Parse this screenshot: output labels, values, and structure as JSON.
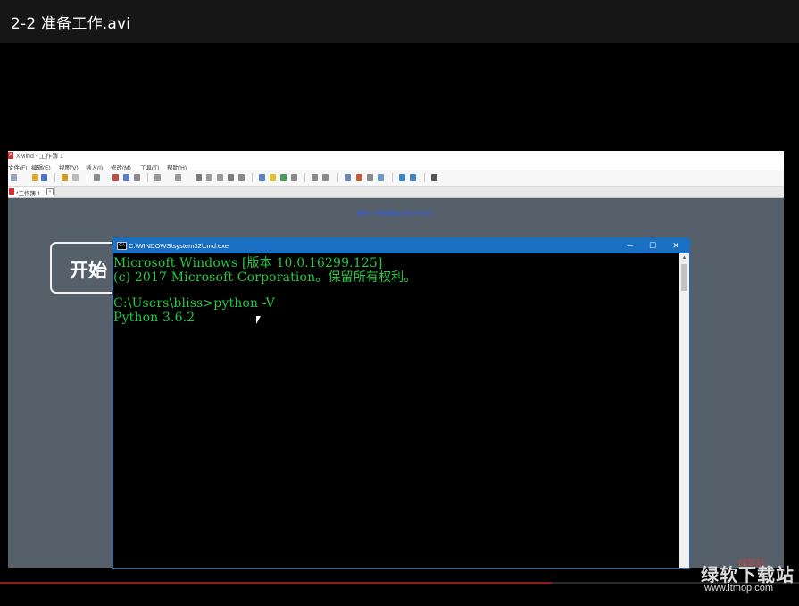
{
  "video": {
    "title": "2-2 准备工作.avi",
    "progress_percent": 69
  },
  "xmind": {
    "window_title": "XMind - 工作簿 1",
    "menu": [
      "文件(F)",
      "编辑(E)",
      "视图(V)",
      "插入(I)",
      "修改(M)",
      "工具(T)",
      "帮助(H)"
    ],
    "tab_label": "*工作簿 1",
    "canvas_link": "更多一手资源加aa791770nbc",
    "topic_text": "开始"
  },
  "cmd": {
    "window_title": "C:\\WINDOWS\\system32\\cmd.exe",
    "lines": [
      "Microsoft Windows [版本 10.0.16299.125]",
      "(c) 2017 Microsoft Corporation。保留所有权利。",
      "",
      "C:\\Users\\bliss>python -V",
      "Python 3.6.2"
    ],
    "text_color": "#27c93f",
    "titlebar_color": "#1b6fc2"
  },
  "watermark": {
    "logo_text": "绿软站",
    "name": "绿软下载站",
    "url": "www.itmop.com"
  }
}
